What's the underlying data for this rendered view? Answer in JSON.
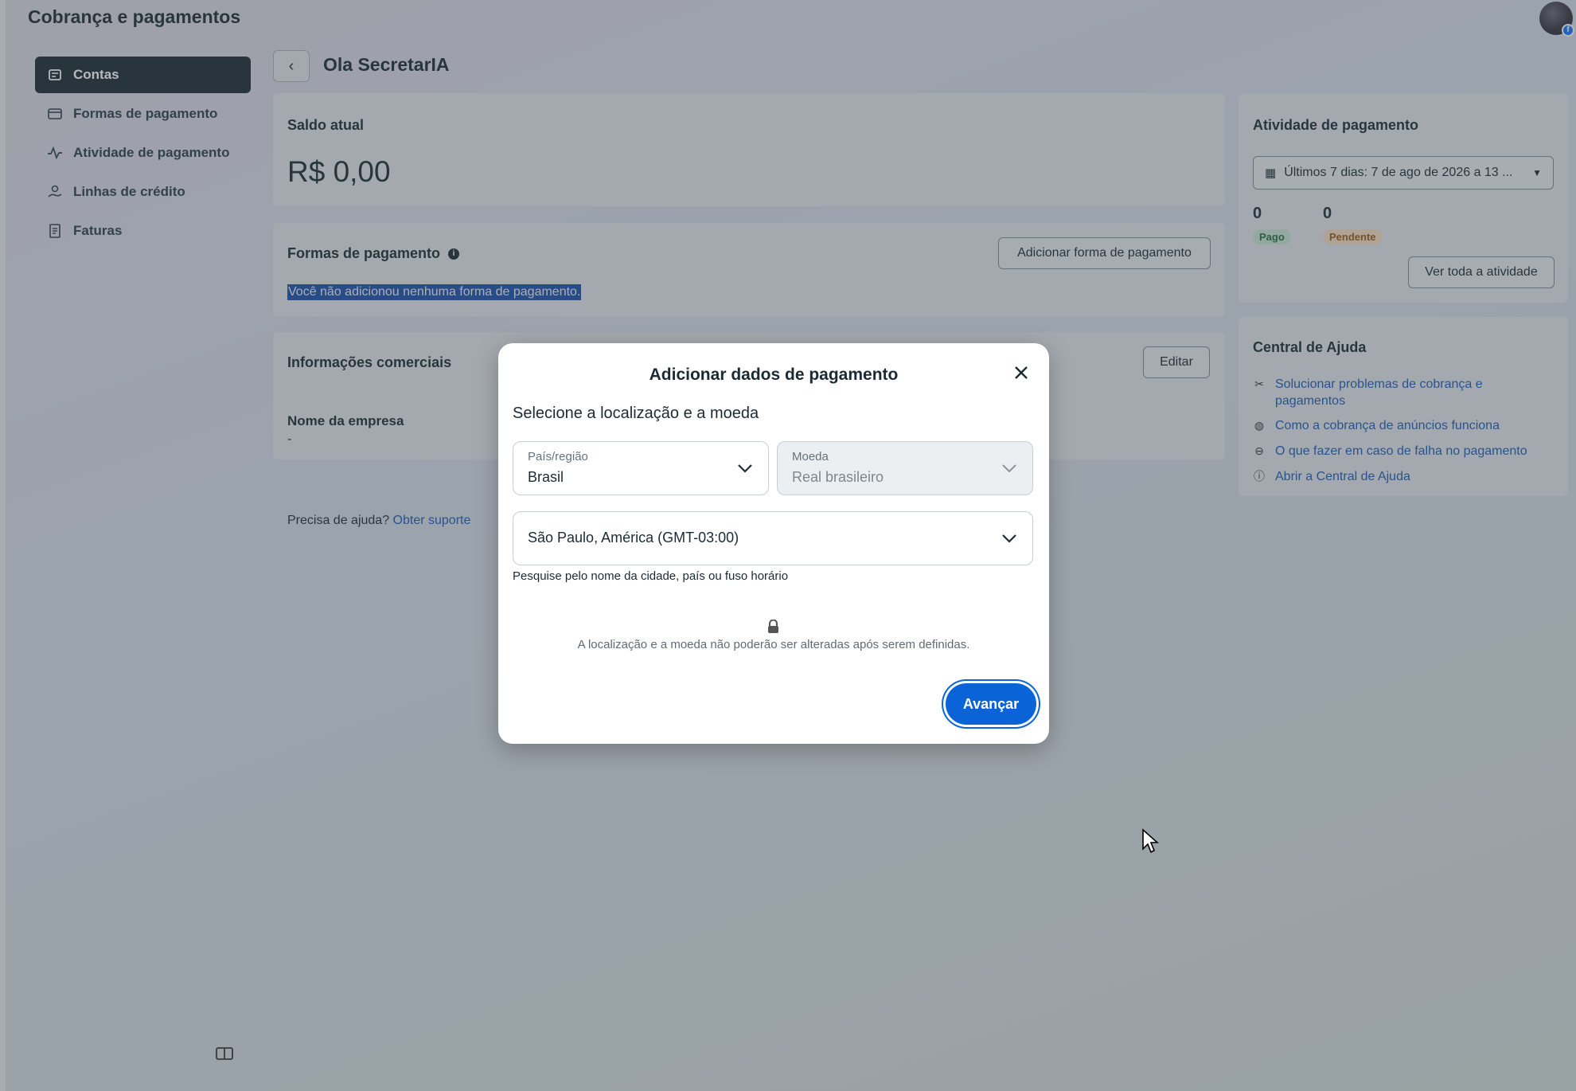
{
  "app": {
    "title": "Cobrança e pagamentos"
  },
  "sidebar": {
    "items": [
      {
        "label": "Contas",
        "icon": "accounts-icon",
        "active": true
      },
      {
        "label": "Formas de pagamento",
        "icon": "card-icon",
        "active": false
      },
      {
        "label": "Atividade de pagamento",
        "icon": "activity-icon",
        "active": false
      },
      {
        "label": "Linhas de crédito",
        "icon": "credit-line-icon",
        "active": false
      },
      {
        "label": "Faturas",
        "icon": "invoice-icon",
        "active": false
      }
    ]
  },
  "main": {
    "account_name": "Ola SecretarIA",
    "balance": {
      "label": "Saldo atual",
      "value": "R$ 0,00"
    },
    "payment_methods": {
      "label": "Formas de pagamento",
      "add_button": "Adicionar forma de pagamento",
      "empty_text": "Você não adicionou nenhuma forma de pagamento."
    },
    "business_info": {
      "label": "Informações comerciais",
      "edit_button": "Editar",
      "company_name_label": "Nome da empresa",
      "company_name_value": "-"
    },
    "help": {
      "prefix": "Precisa de ajuda?",
      "link": "Obter suporte"
    }
  },
  "activity": {
    "title": "Atividade de pagamento",
    "date_range": "Últimos 7 dias: 7 de ago de 2026 a 13 ...",
    "paid": {
      "count": "0",
      "label": "Pago"
    },
    "pending": {
      "count": "0",
      "label": "Pendente"
    },
    "view_all": "Ver toda a atividade"
  },
  "help_center": {
    "title": "Central de Ajuda",
    "links": [
      {
        "line1": "Solucionar problemas de cobrança e",
        "line2": "pagamentos",
        "icon": "tools-icon"
      },
      {
        "line1": "Como a cobrança de anúncios funciona",
        "icon": "globe-icon"
      },
      {
        "line1": "O que fazer em caso de falha no pagamento",
        "icon": "minus-circle-icon"
      },
      {
        "line1": "Abrir a Central de Ajuda",
        "icon": "help-circle-icon"
      }
    ]
  },
  "modal": {
    "title": "Adicionar dados de pagamento",
    "section_title": "Selecione a localização e a moeda",
    "country": {
      "label": "País/região",
      "value": "Brasil"
    },
    "currency": {
      "label": "Moeda",
      "value": "Real brasileiro"
    },
    "timezone": {
      "value": "São Paulo, América (GMT-03:00)",
      "help": "Pesquise pelo nome da cidade, país ou fuso horário"
    },
    "lock_note": "A localização e a moeda não poderão ser alteradas após serem definidas.",
    "next_button": "Avançar"
  },
  "colors": {
    "primary": "#0a64d8",
    "sidebar_active": "#1c2b33",
    "link": "#1d5bb5"
  }
}
